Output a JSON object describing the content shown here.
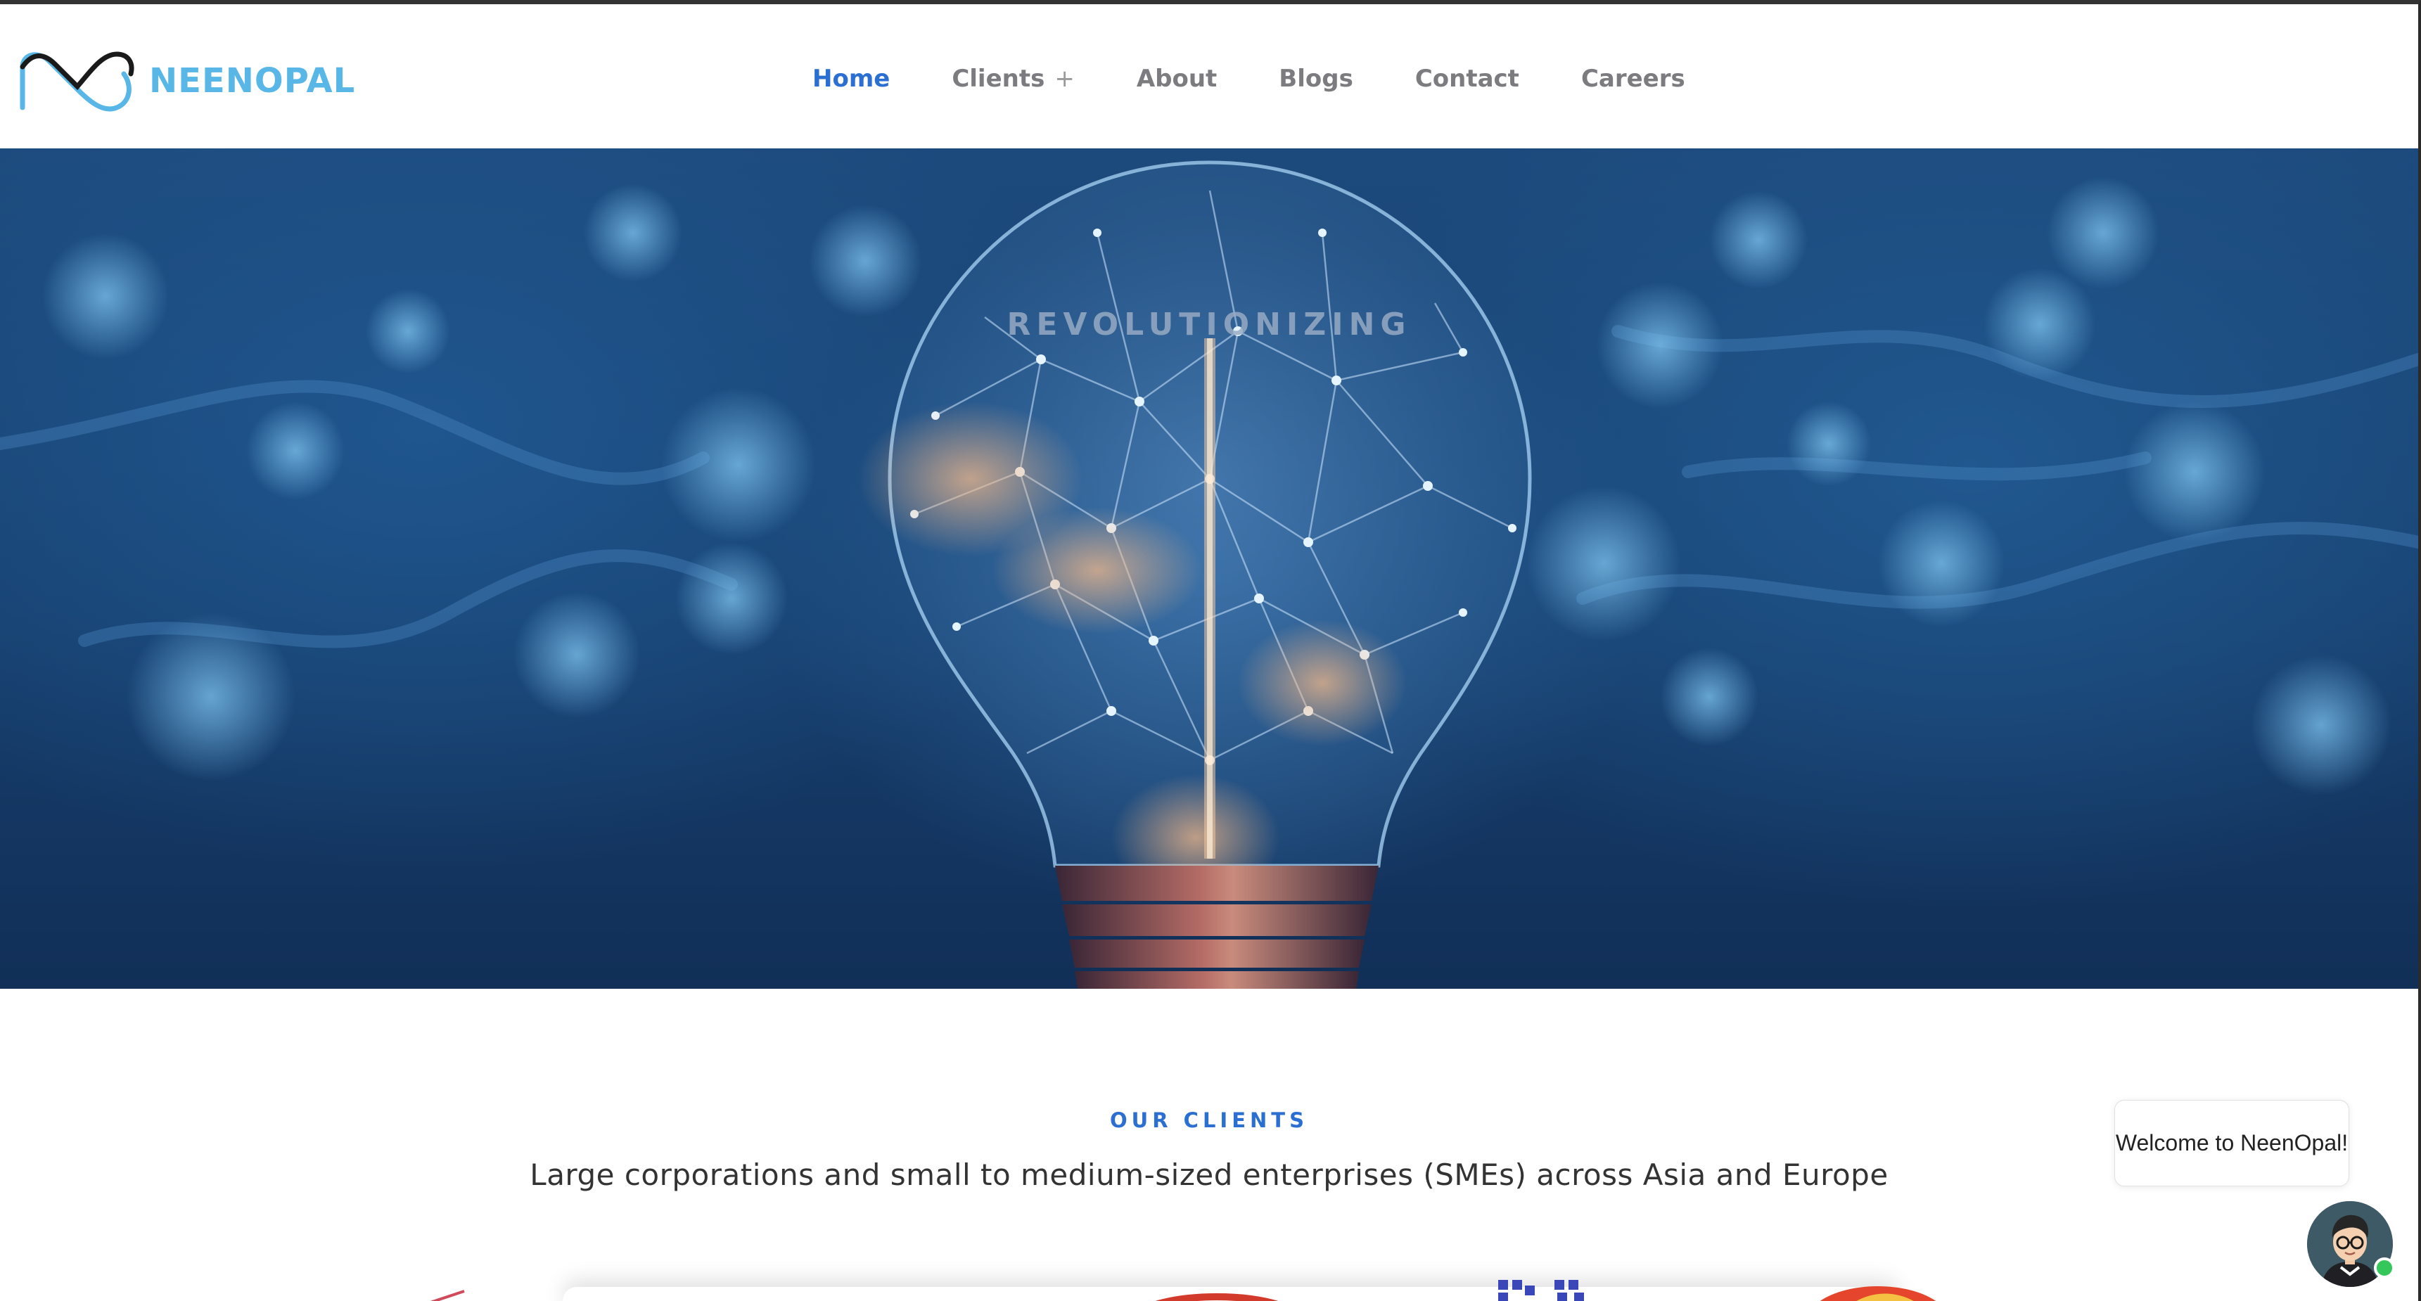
{
  "brand": {
    "name": "NEENOPAL",
    "color": "#58b7e6"
  },
  "nav": {
    "items": [
      {
        "label": "Home",
        "active": true
      },
      {
        "label": "Clients",
        "has_submenu": true,
        "submenu_icon": "+"
      },
      {
        "label": "About"
      },
      {
        "label": "Blogs"
      },
      {
        "label": "Contact"
      },
      {
        "label": "Careers"
      }
    ],
    "active_color": "#2a6fd1",
    "inactive_color": "#7c7c80"
  },
  "hero": {
    "title": "REVOLUTIONIZING",
    "image": "lightbulb-network-icon"
  },
  "clients": {
    "kicker": "OUR CLIENTS",
    "subtitle": "Large corporations and small to medium-sized enterprises (SMEs) across Asia and Europe"
  },
  "chat": {
    "greeting": "Welcome to NeenOpal!",
    "status": "online"
  }
}
